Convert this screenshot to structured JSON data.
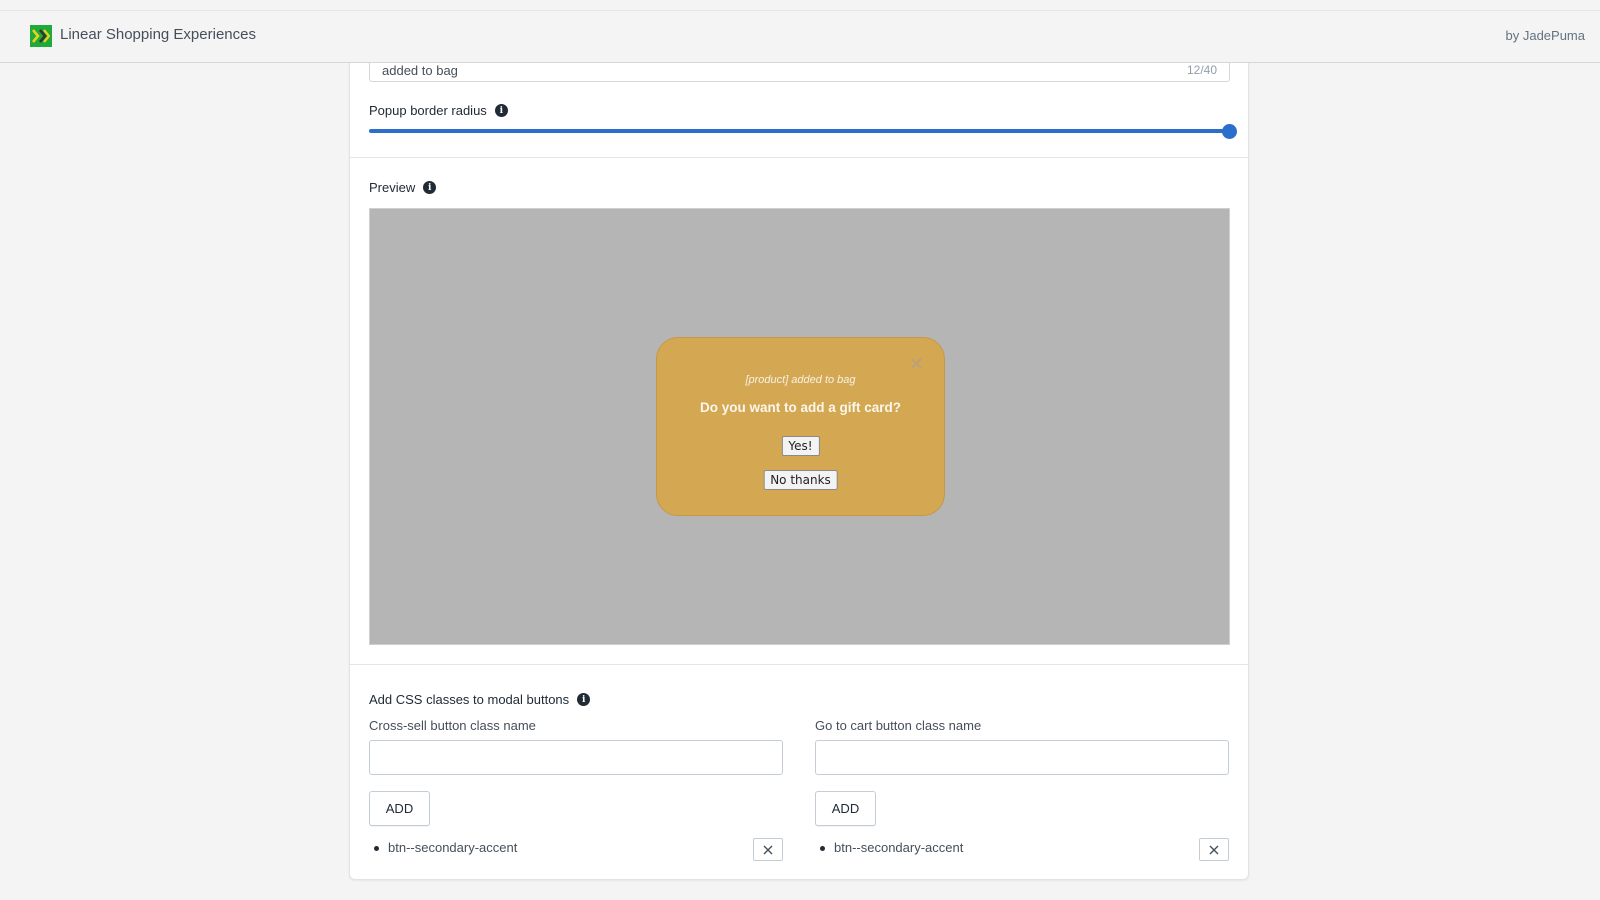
{
  "header": {
    "app_title": "Linear Shopping Experiences",
    "logo_icon": "double-chevron-right-icon",
    "byline": "by JadePuma",
    "logo_color": "#1faa3a"
  },
  "settings": {
    "top_input": {
      "value": "added to bag",
      "char_count": "12/40"
    },
    "popup_border_radius": {
      "label": "Popup border radius",
      "info_icon": "info-icon",
      "value_fraction": 1.0,
      "accent": "#2c6ecb"
    },
    "preview": {
      "label": "Preview",
      "info_icon": "info-icon",
      "backdrop_color": "#b5b5b5",
      "modal": {
        "background": "#d4a853",
        "close_icon": "close-icon",
        "subtitle": "[product] added to bag",
        "question": "Do you want to add a gift card?",
        "yes_label": "Yes!",
        "no_label": "No thanks"
      }
    },
    "css_classes": {
      "label": "Add CSS classes to modal buttons",
      "info_icon": "info-icon",
      "cross_sell": {
        "label": "Cross-sell button class name",
        "value": "",
        "add_label": "ADD",
        "classes": [
          "btn--secondary-accent"
        ]
      },
      "go_to_cart": {
        "label": "Go to cart button class name",
        "value": "",
        "add_label": "ADD",
        "classes": [
          "btn--secondary-accent"
        ]
      }
    }
  }
}
